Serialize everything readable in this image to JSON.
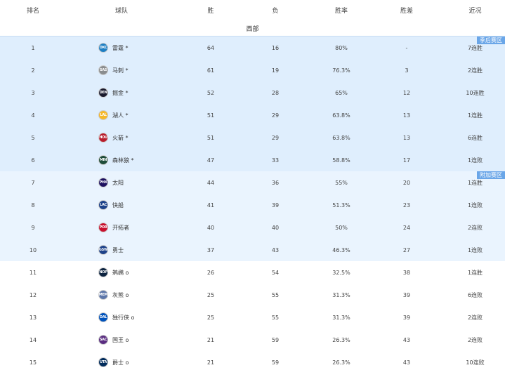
{
  "header": {
    "rank": "排名",
    "team": "球队",
    "wins": "胜",
    "losses": "负",
    "pct": "胜率",
    "gb": "胜差",
    "streak": "近况"
  },
  "conference": "西部",
  "tags": {
    "playoff": "季后赛区",
    "playin": "附加赛区"
  },
  "teams": [
    {
      "rank": "1",
      "abbr": "OKC",
      "name": "雷霆 *",
      "w": "64",
      "l": "16",
      "pct": "80%",
      "gb": "-",
      "streak": "7连胜",
      "color": "#1d7fc4"
    },
    {
      "rank": "2",
      "abbr": "SAS",
      "name": "马刺 *",
      "w": "61",
      "l": "19",
      "pct": "76.3%",
      "gb": "3",
      "streak": "2连胜",
      "color": "#8a8d8f"
    },
    {
      "rank": "3",
      "abbr": "DEN",
      "name": "掘金 *",
      "w": "52",
      "l": "28",
      "pct": "65%",
      "gb": "12",
      "streak": "10连胜",
      "color": "#1a1a2e"
    },
    {
      "rank": "4",
      "abbr": "LAL",
      "name": "湖人 *",
      "w": "51",
      "l": "29",
      "pct": "63.8%",
      "gb": "13",
      "streak": "1连胜",
      "color": "#f5b82a"
    },
    {
      "rank": "5",
      "abbr": "HOU",
      "name": "火箭 *",
      "w": "51",
      "l": "29",
      "pct": "63.8%",
      "gb": "13",
      "streak": "6连胜",
      "color": "#b81c2c"
    },
    {
      "rank": "6",
      "abbr": "MIN",
      "name": "森林狼 *",
      "w": "47",
      "l": "33",
      "pct": "58.8%",
      "gb": "17",
      "streak": "1连败",
      "color": "#1e4d3a"
    },
    {
      "rank": "7",
      "abbr": "PHX",
      "name": "太阳",
      "w": "44",
      "l": "36",
      "pct": "55%",
      "gb": "20",
      "streak": "1连胜",
      "color": "#1d1160"
    },
    {
      "rank": "8",
      "abbr": "LAC",
      "name": "快船",
      "w": "41",
      "l": "39",
      "pct": "51.3%",
      "gb": "23",
      "streak": "1连败",
      "color": "#1d428a"
    },
    {
      "rank": "9",
      "abbr": "POR",
      "name": "开拓者",
      "w": "40",
      "l": "40",
      "pct": "50%",
      "gb": "24",
      "streak": "2连败",
      "color": "#c8102e"
    },
    {
      "rank": "10",
      "abbr": "GSW",
      "name": "勇士",
      "w": "37",
      "l": "43",
      "pct": "46.3%",
      "gb": "27",
      "streak": "1连败",
      "color": "#1d428a"
    },
    {
      "rank": "11",
      "abbr": "NOP",
      "name": "鹈鹕 o",
      "w": "26",
      "l": "54",
      "pct": "32.5%",
      "gb": "38",
      "streak": "1连胜",
      "color": "#0c2340"
    },
    {
      "rank": "12",
      "abbr": "MEM",
      "name": "灰熊 o",
      "w": "25",
      "l": "55",
      "pct": "31.3%",
      "gb": "39",
      "streak": "6连败",
      "color": "#5d76a9"
    },
    {
      "rank": "13",
      "abbr": "DAL",
      "name": "独行侠 o",
      "w": "25",
      "l": "55",
      "pct": "31.3%",
      "gb": "39",
      "streak": "2连败",
      "color": "#0053bc"
    },
    {
      "rank": "14",
      "abbr": "SAC",
      "name": "国王 o",
      "w": "21",
      "l": "59",
      "pct": "26.3%",
      "gb": "43",
      "streak": "2连败",
      "color": "#5a2d81"
    },
    {
      "rank": "15",
      "abbr": "UTA",
      "name": "爵士 o",
      "w": "21",
      "l": "59",
      "pct": "26.3%",
      "gb": "43",
      "streak": "10连败",
      "color": "#002b5c"
    }
  ]
}
